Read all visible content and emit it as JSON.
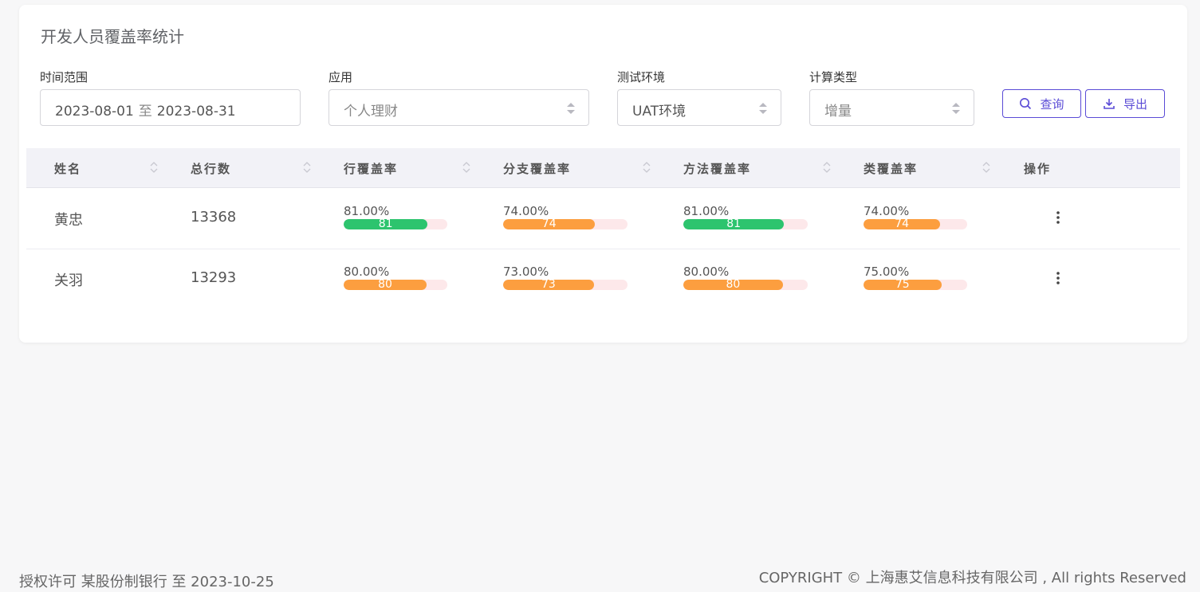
{
  "page": {
    "title": "开发人员覆盖率统计"
  },
  "filters": {
    "time": {
      "label": "时间范围",
      "start": "2023-08-01",
      "separator": "至",
      "end": "2023-08-31"
    },
    "app": {
      "label": "应用",
      "placeholder": "个人理财"
    },
    "env": {
      "label": "测试环境",
      "value": "UAT环境"
    },
    "calc": {
      "label": "计算类型",
      "placeholder": "增量"
    }
  },
  "buttons": {
    "query": "查询",
    "export": "导出"
  },
  "table": {
    "headers": {
      "name": "姓名",
      "total_lines": "总行数",
      "line_cov": "行覆盖率",
      "branch_cov": "分支覆盖率",
      "method_cov": "方法覆盖率",
      "class_cov": "类覆盖率",
      "actions": "操作"
    },
    "rows": [
      {
        "name": "黄忠",
        "total_lines": "13368",
        "line": {
          "pct": "81.00%",
          "bar": "81",
          "value": 81,
          "color": "#2dc46e"
        },
        "branch": {
          "pct": "74.00%",
          "bar": "74",
          "value": 74,
          "color": "#fc9e3f"
        },
        "method": {
          "pct": "81.00%",
          "bar": "81",
          "value": 81,
          "color": "#2dc46e"
        },
        "class": {
          "pct": "74.00%",
          "bar": "74",
          "value": 74,
          "color": "#fc9e3f"
        }
      },
      {
        "name": "关羽",
        "total_lines": "13293",
        "line": {
          "pct": "80.00%",
          "bar": "80",
          "value": 80,
          "color": "#fc9e3f"
        },
        "branch": {
          "pct": "73.00%",
          "bar": "73",
          "value": 73,
          "color": "#fc9e3f"
        },
        "method": {
          "pct": "80.00%",
          "bar": "80",
          "value": 80,
          "color": "#fc9e3f"
        },
        "class": {
          "pct": "75.00%",
          "bar": "75",
          "value": 75,
          "color": "#fc9e3f"
        }
      }
    ]
  },
  "footer": {
    "license": "授权许可 某股份制银行 至 2023-10-25",
    "copyright": "COPYRIGHT © 上海惠艾信息科技有限公司 , All rights Reserved"
  },
  "colors": {
    "accent": "#5a4bd6",
    "success": "#2dc46e",
    "warning": "#fc9e3f",
    "bar_track": "#fde8ea"
  }
}
